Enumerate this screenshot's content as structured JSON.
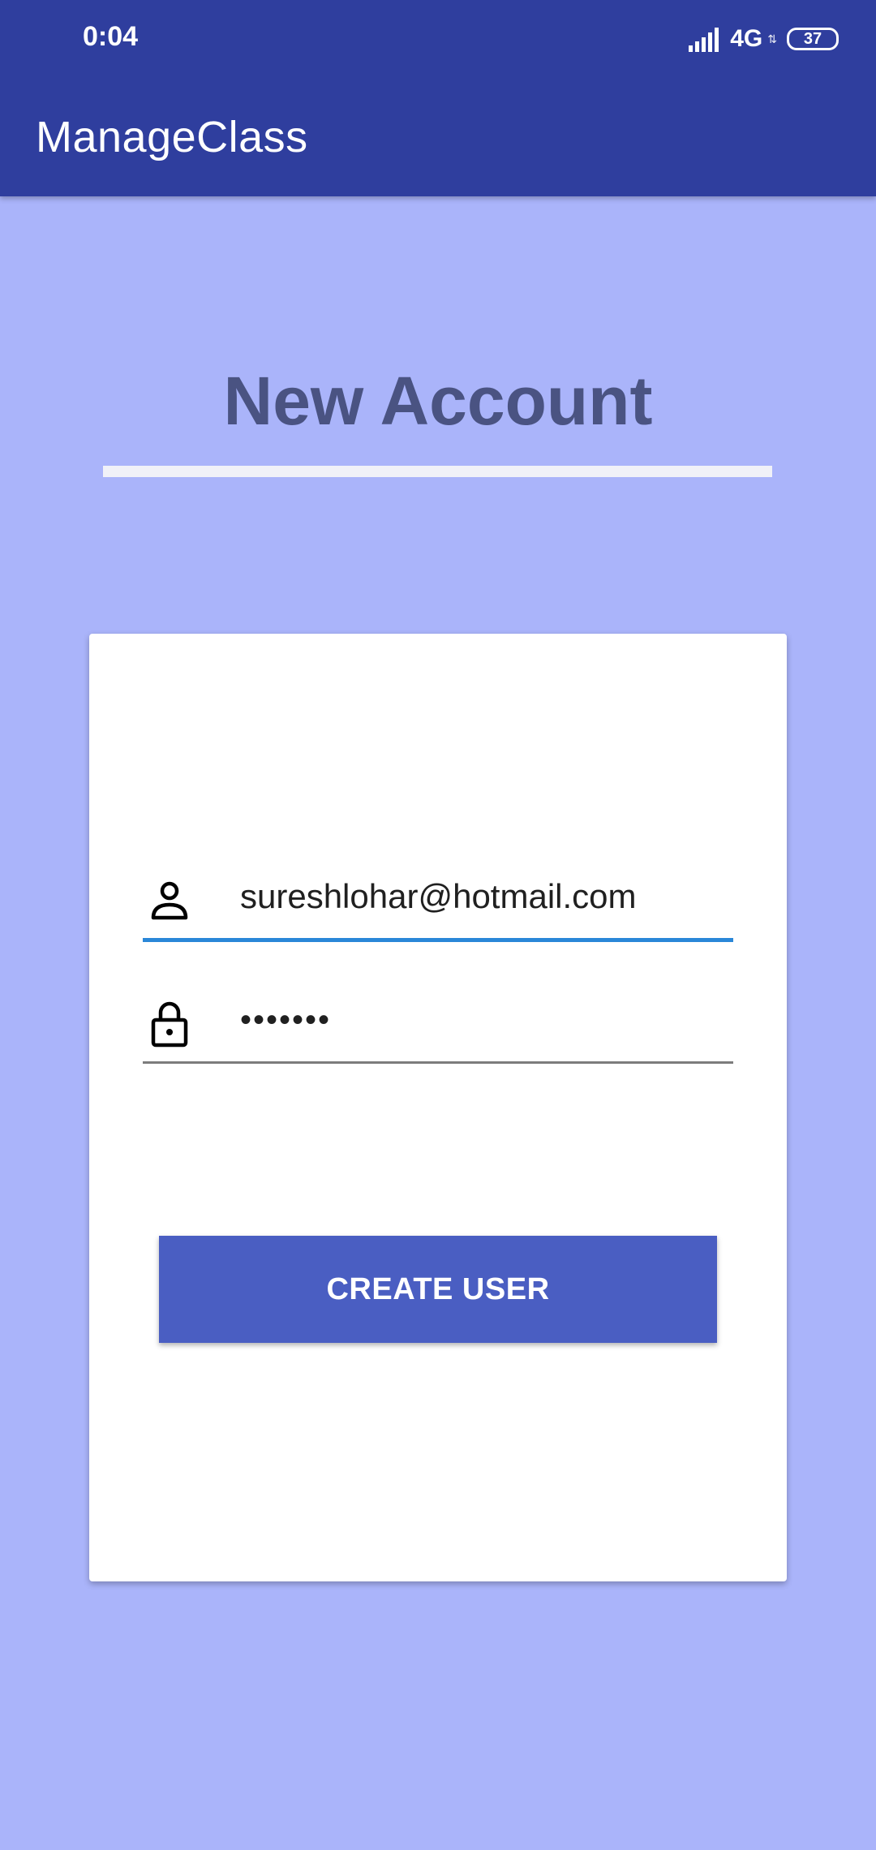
{
  "status_bar": {
    "time": "0:04",
    "network": "4G",
    "network_arrows": "⇅",
    "battery": "37"
  },
  "app_bar": {
    "title": "ManageClass",
    "color": "#2f3e9e"
  },
  "page": {
    "heading": "New Account",
    "background_color": "#aab4fa"
  },
  "form": {
    "email": {
      "icon": "person-icon",
      "value": "sureshlohar@hotmail.com"
    },
    "password": {
      "icon": "lock-icon",
      "value": "•••••••"
    },
    "submit_label": "CREATE USER",
    "accent_color": "#2a87d8",
    "button_color": "#4a5ec2"
  }
}
